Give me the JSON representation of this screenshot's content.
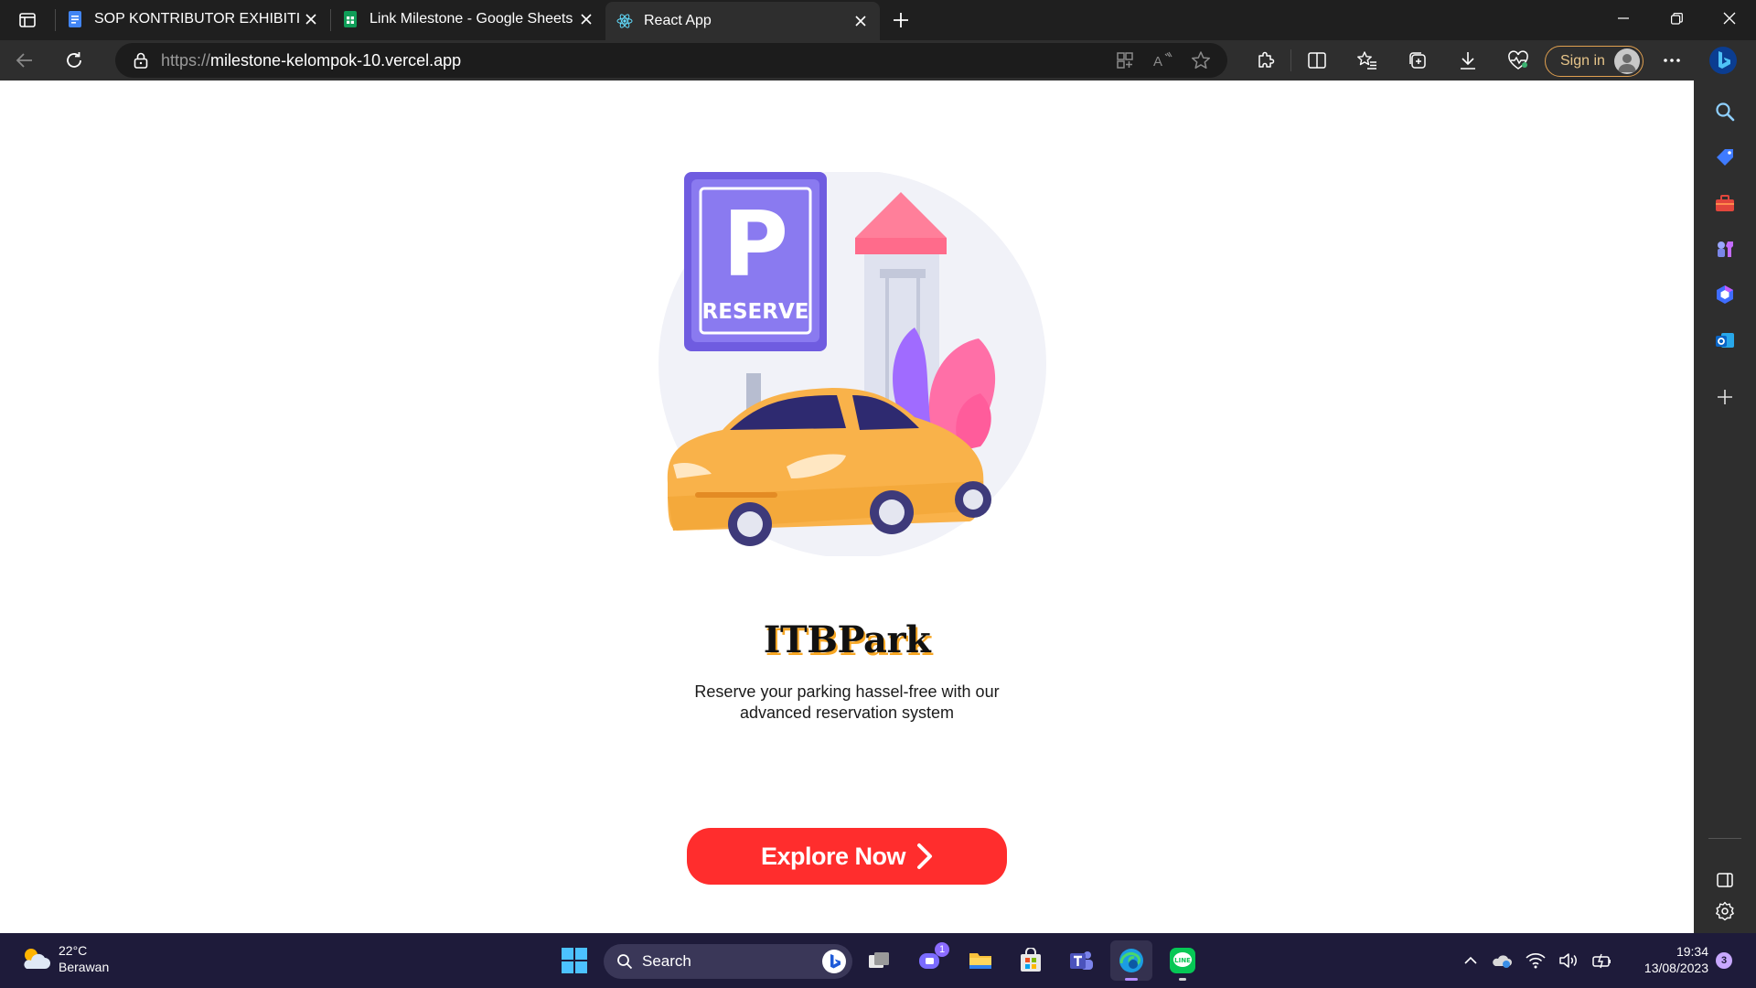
{
  "browser": {
    "tabs": [
      {
        "title": "SOP KONTRIBUTOR EXHIBITION",
        "icon": "google-docs-icon",
        "active": false
      },
      {
        "title": "Link Milestone - Google Sheets",
        "icon": "google-sheets-icon",
        "active": false
      },
      {
        "title": "React App",
        "icon": "react-icon",
        "active": true
      }
    ],
    "url_protocol": "https://",
    "url_host": "milestone-kelompok-10.vercel.app",
    "signin_label": "Sign in"
  },
  "page": {
    "brand": "ITBPark",
    "tagline": "Reserve your parking hassel-free with our advanced reservation system",
    "cta_label": "Explore Now",
    "illustration": {
      "sign_letter": "P",
      "sign_text": "RESERVE"
    }
  },
  "taskbar": {
    "weather_temp": "22°C",
    "weather_desc": "Berawan",
    "search_label": "Search",
    "chat_badge": "1",
    "time": "19:34",
    "date": "13/08/2023",
    "notification_count": "3"
  },
  "colors": {
    "accent_cta": "#ff2d2d",
    "brand_shadow": "#f6a623",
    "sign_purple": "#6f5ce0",
    "car_orange": "#f9b24a"
  }
}
